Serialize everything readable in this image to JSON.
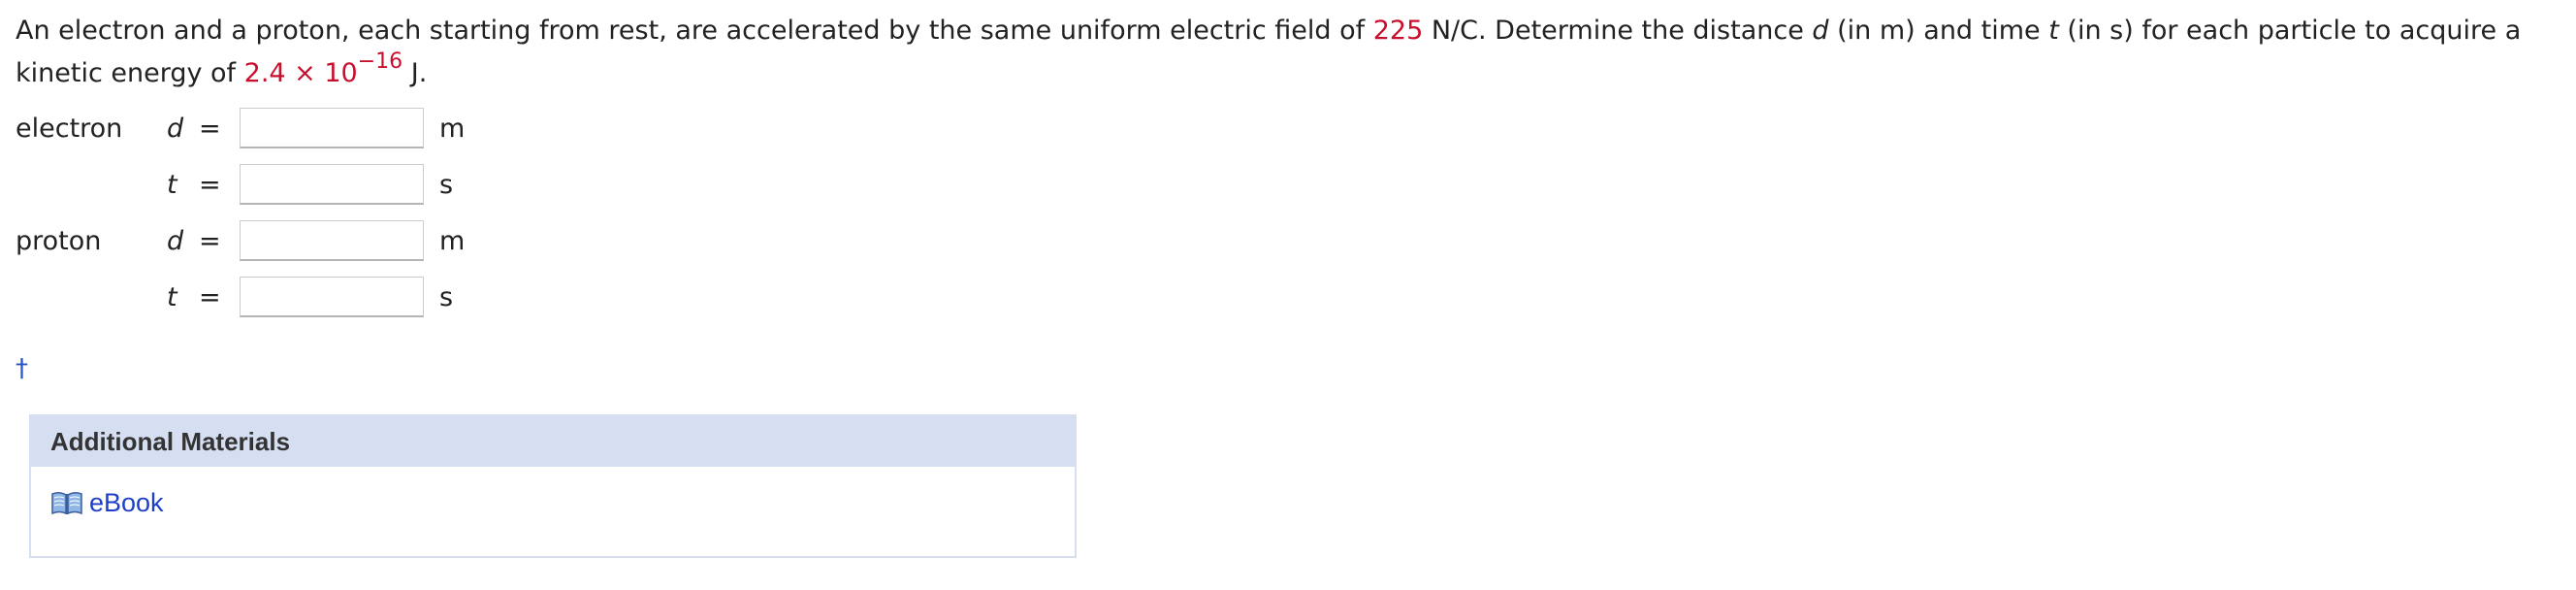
{
  "question": {
    "p1": "An electron and a proton, each starting from rest, are accelerated by the same uniform electric field of ",
    "field_value": "225",
    "p2": " N/C. Determine the distance ",
    "var_d": "d",
    "p3": " (in m) and time ",
    "var_t": "t",
    "p4": " (in s) for each particle to acquire a kinetic energy of ",
    "energy_value": "2.4 × 10",
    "energy_exponent": "−16",
    "p5": " J."
  },
  "answers": {
    "electron": {
      "label": "electron",
      "d": {
        "var": "d",
        "equals": "=",
        "value": "",
        "unit": "m"
      },
      "t": {
        "var": "t",
        "equals": "=",
        "value": "",
        "unit": "s"
      }
    },
    "proton": {
      "label": "proton",
      "d": {
        "var": "d",
        "equals": "=",
        "value": "",
        "unit": "m"
      },
      "t": {
        "var": "t",
        "equals": "=",
        "value": "",
        "unit": "s"
      }
    }
  },
  "dagger": "†",
  "additional_materials": {
    "header": "Additional Materials",
    "ebook_label": "eBook",
    "ebook_icon": "open-book-icon"
  },
  "colors": {
    "highlight": "#c8102e",
    "link": "#1d3fc9",
    "panel_header_bg": "#d6def1"
  }
}
